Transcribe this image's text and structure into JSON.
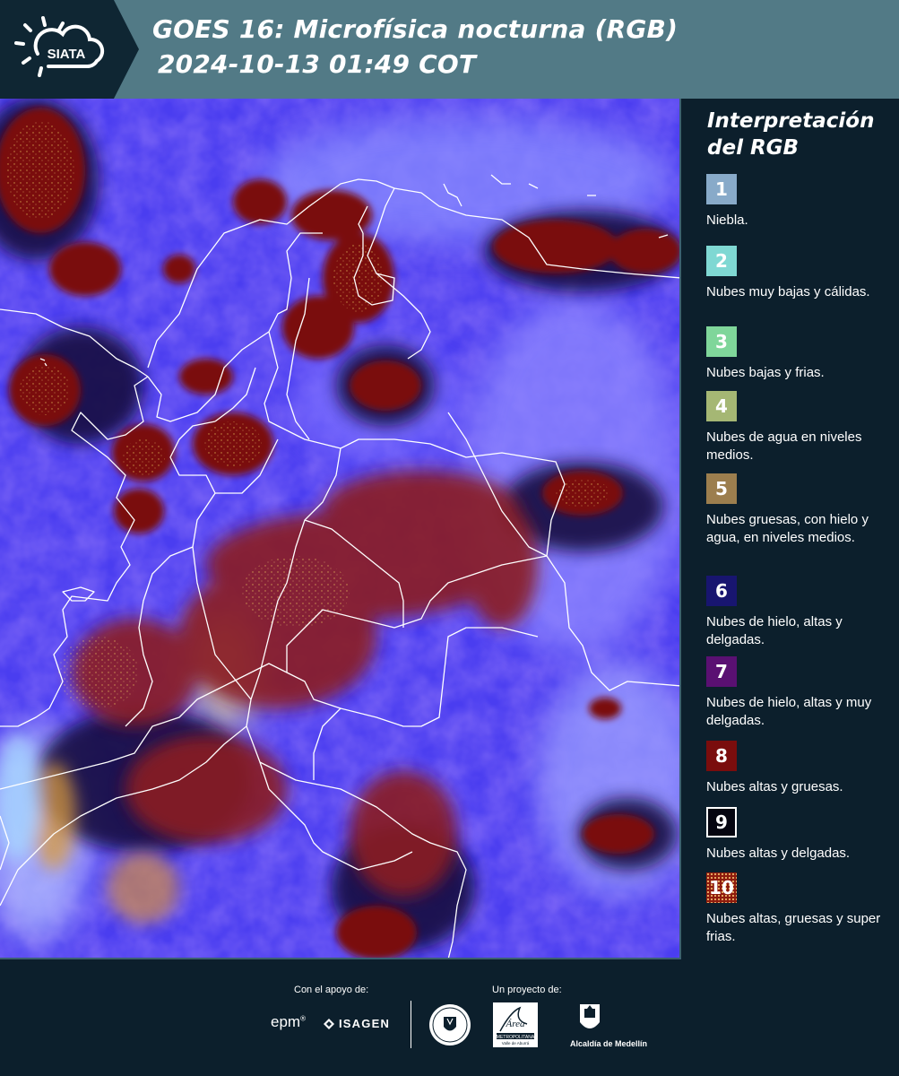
{
  "header": {
    "logo_text": "SIATA",
    "title_line1": "GOES 16: Microfísica nocturna (RGB)",
    "title_line2": "2024-10-13 01:49 COT",
    "bg_color": "#527a86"
  },
  "legend": {
    "title": "Interpretación del RGB",
    "items": [
      {
        "number": "1",
        "label": "Niebla.",
        "color": "#88aac9"
      },
      {
        "number": "2",
        "label": "Nubes muy bajas y cálidas.",
        "color": "#7fd8d3"
      },
      {
        "number": "3",
        "label": "Nubes bajas y frias.",
        "color": "#7fd69a"
      },
      {
        "number": "4",
        "label": "Nubes de agua en niveles medios.",
        "color": "#a5b774"
      },
      {
        "number": "5",
        "label": "Nubes gruesas, con hielo y agua, en niveles medios.",
        "color": "#9c7e4e"
      },
      {
        "number": "6",
        "label": "Nubes de hielo, altas y delgadas.",
        "color": "#181570"
      },
      {
        "number": "7",
        "label": "Nubes de hielo, altas y muy delgadas.",
        "color": "#5a1072"
      },
      {
        "number": "8",
        "label": "Nubes altas y gruesas.",
        "color": "#7a0d0d"
      },
      {
        "number": "9",
        "label": "Nubes altas y delgadas.",
        "color": "#050510"
      },
      {
        "number": "10",
        "label": "Nubes altas, gruesas y super frias.",
        "color": "#8e1c0e"
      }
    ]
  },
  "footer": {
    "support_caption": "Con el apoyo de:",
    "project_caption": "Un proyecto de:",
    "epm_logo": "epm",
    "isagen_logo": "ISAGEN",
    "amva_logo": "Área METROPOLITANA Valle de Aburrá",
    "alcaldia_logo": "Alcaldía de Medellín"
  }
}
